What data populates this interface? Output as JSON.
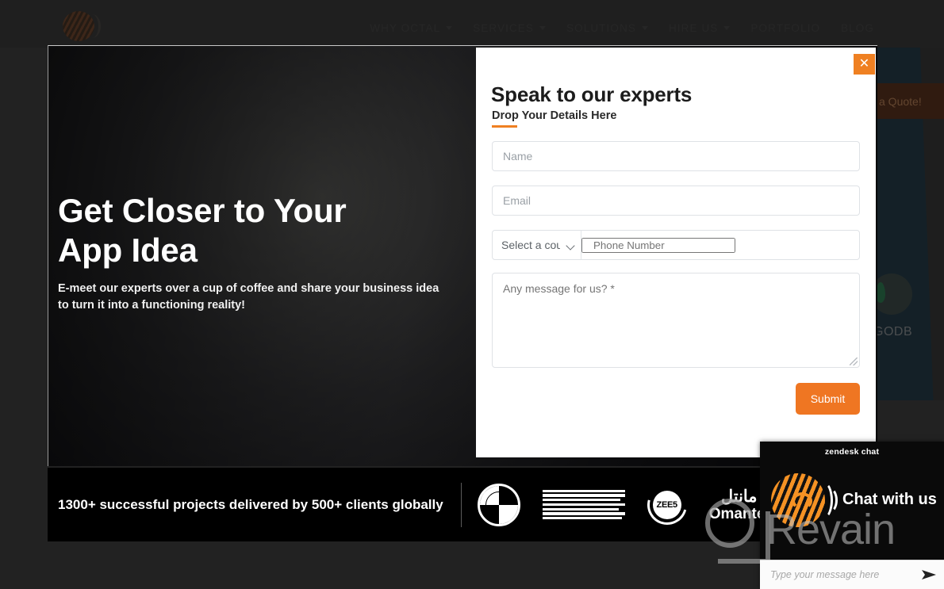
{
  "site": {
    "logo_icon": "octal-sphere-logo"
  },
  "nav": {
    "items": [
      {
        "label": "WHY OCTAL",
        "has_dropdown": true
      },
      {
        "label": "SERVICES",
        "has_dropdown": true
      },
      {
        "label": "SOLUTIONS",
        "has_dropdown": true
      },
      {
        "label": "HIRE US",
        "has_dropdown": true
      },
      {
        "label": "PORTFOLIO",
        "has_dropdown": false
      },
      {
        "label": "BLOG",
        "has_dropdown": false
      }
    ]
  },
  "hero": {
    "title_line1": "Get Closer to Your",
    "title_line2": "App Idea",
    "subtitle": "E-meet our experts over a cup of coffee and share your business idea to turn it into a functioning reality!"
  },
  "right_edge": {
    "quote_button": "a Quote!",
    "mongodb_label": "GODB"
  },
  "clients": {
    "text": "1300+ successful projects delivered by 500+ clients globally",
    "logos": [
      {
        "name": "bmw-logo",
        "label": "BMW"
      },
      {
        "name": "ibm-logo",
        "label": "IBM"
      },
      {
        "name": "zee5-logo",
        "label": "ZEE5"
      },
      {
        "name": "omantel-logo",
        "label_ar": "مانتل",
        "label_en": "Omantel"
      }
    ]
  },
  "modal": {
    "title": "Speak to our experts",
    "subtitle": "Drop Your Details Here",
    "close_label": "✕",
    "accent_color": "#ef8022",
    "fields": {
      "name_placeholder": "Name",
      "email_placeholder": "Email",
      "country_selected": "Select a cou",
      "phone_placeholder": "Phone Number",
      "message_placeholder": "Any message for us? *"
    },
    "submit_label": "Submit"
  },
  "chat": {
    "header": "zendesk chat",
    "cta": "Chat with us",
    "watermark": "Revain",
    "input_placeholder": "Type your message here",
    "send_icon": "send-arrow-icon"
  }
}
